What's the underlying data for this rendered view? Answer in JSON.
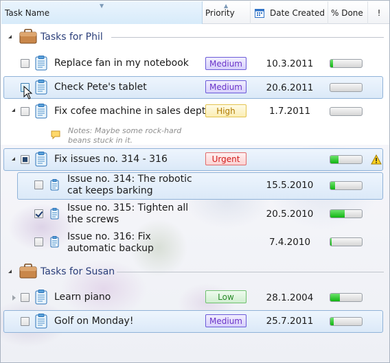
{
  "header": {
    "task_name": "Task Name",
    "priority": "Priority",
    "date_created": "Date Created",
    "percent_done": "% Done",
    "flag": "!"
  },
  "groups": [
    {
      "label": "Tasks for Phil"
    },
    {
      "label": "Tasks for Susan"
    }
  ],
  "tasks": [
    {
      "label": "Replace fan in my notebook",
      "priority": "Medium",
      "date": "10.3.2011",
      "done": 0.08
    },
    {
      "label": "Check Pete's tablet",
      "priority": "Medium",
      "date": "20.6.2011",
      "done": 0.0
    },
    {
      "label": "Fix cofee machine in sales dept",
      "priority": "High",
      "date": "1.7.2011",
      "done": 0.0,
      "note": "Notes: Maybe some rock-hard beans stuck in it."
    },
    {
      "label": "Fix issues no. 314 - 316",
      "priority": "Urgent",
      "date": "",
      "done": 0.25,
      "warning": true
    },
    {
      "label": "Issue no. 314: The robotic cat keeps barking",
      "priority": "",
      "date": "15.5.2010",
      "done": 0.15
    },
    {
      "label": "Issue no. 315: Tighten all the screws",
      "priority": "",
      "date": "20.5.2010",
      "done": 0.45
    },
    {
      "label": "Issue no. 316: Fix automatic backup",
      "priority": "",
      "date": "7.4.2010",
      "done": 0.05
    },
    {
      "label": "Learn piano",
      "priority": "Low",
      "date": "28.1.2004",
      "done": 0.3
    },
    {
      "label": "Golf on Monday!",
      "priority": "Medium",
      "date": "25.7.2011",
      "done": 0.1
    }
  ],
  "colors": {
    "medium": "#6a33c8",
    "high": "#d69a00",
    "urgent": "#d11c1c",
    "low": "#2b8a2b",
    "progress": "#17b817",
    "selection": "#dbe9f8"
  }
}
